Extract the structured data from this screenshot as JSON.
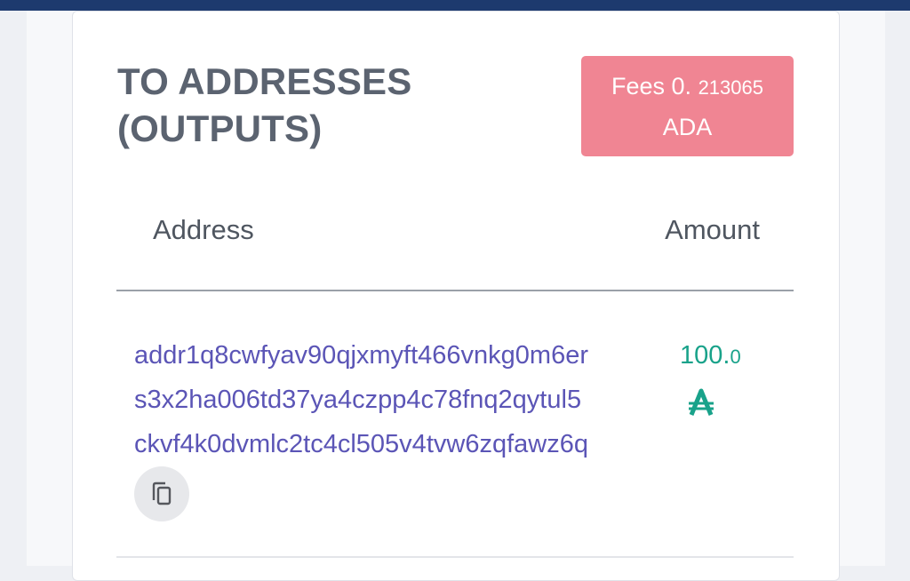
{
  "section": {
    "title_line1": "TO ADDRESSES",
    "title_line2": "(OUTPUTS)"
  },
  "fees": {
    "label": "Fees 0.",
    "value_small": "213065",
    "unit": "ADA"
  },
  "table": {
    "columns": [
      "Address",
      "Amount"
    ],
    "rows": [
      {
        "address_lines": [
          "addr1q8cwfyav90qjxmyft466vnkg0m6er",
          "s3x2ha006td37ya4czpp4c78fnq2qytul5",
          "ckvf4k0dvmlc2tc4cl505v4tvw6zqfawz6q"
        ],
        "amount_main": "100.",
        "amount_small": "0",
        "currency_icon": "ada-icon",
        "copy_icon": "copy-icon"
      }
    ]
  },
  "colors": {
    "header_bar": "#1d3a6e",
    "fees_badge": "#f08593",
    "address_link": "#5b55b6",
    "amount": "#19a28a",
    "title": "#5b6370"
  }
}
